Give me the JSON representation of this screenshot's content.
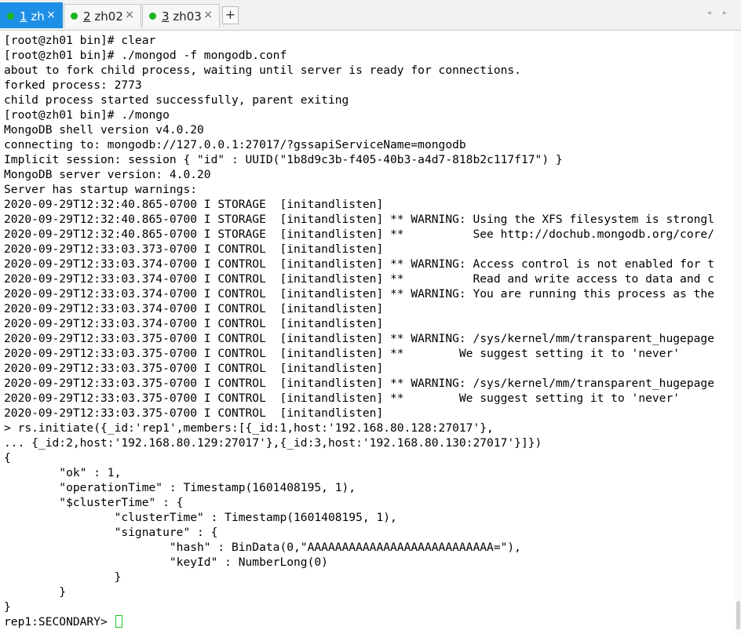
{
  "tabs": [
    {
      "num": "1",
      "name": "zh",
      "close": "×",
      "active": true
    },
    {
      "num": "2",
      "name": "zh02",
      "close": "×",
      "active": false
    },
    {
      "num": "3",
      "name": "zh03",
      "close": "×",
      "active": false
    }
  ],
  "new_tab_label": "+",
  "nav_arrows": "◂ ▸",
  "colors": {
    "active_tab": "#1e8fe6",
    "status_dot": "#18b51e",
    "cursor": "#19c419",
    "terminal_bg": "#ffffff",
    "terminal_fg": "#000000"
  },
  "terminal": {
    "lines": [
      "[root@zh01 bin]# clear",
      "[root@zh01 bin]# ./mongod -f mongodb.conf",
      "about to fork child process, waiting until server is ready for connections.",
      "forked process: 2773",
      "child process started successfully, parent exiting",
      "[root@zh01 bin]# ./mongo",
      "MongoDB shell version v4.0.20",
      "connecting to: mongodb://127.0.0.1:27017/?gssapiServiceName=mongodb",
      "Implicit session: session { \"id\" : UUID(\"1b8d9c3b-f405-40b3-a4d7-818b2c117f17\") }",
      "MongoDB server version: 4.0.20",
      "Server has startup warnings:",
      "2020-09-29T12:32:40.865-0700 I STORAGE  [initandlisten]",
      "2020-09-29T12:32:40.865-0700 I STORAGE  [initandlisten] ** WARNING: Using the XFS filesystem is strongl",
      "2020-09-29T12:32:40.865-0700 I STORAGE  [initandlisten] **          See http://dochub.mongodb.org/core/",
      "2020-09-29T12:33:03.373-0700 I CONTROL  [initandlisten]",
      "2020-09-29T12:33:03.374-0700 I CONTROL  [initandlisten] ** WARNING: Access control is not enabled for t",
      "2020-09-29T12:33:03.374-0700 I CONTROL  [initandlisten] **          Read and write access to data and c",
      "2020-09-29T12:33:03.374-0700 I CONTROL  [initandlisten] ** WARNING: You are running this process as the",
      "2020-09-29T12:33:03.374-0700 I CONTROL  [initandlisten]",
      "2020-09-29T12:33:03.374-0700 I CONTROL  [initandlisten]",
      "2020-09-29T12:33:03.375-0700 I CONTROL  [initandlisten] ** WARNING: /sys/kernel/mm/transparent_hugepage",
      "2020-09-29T12:33:03.375-0700 I CONTROL  [initandlisten] **        We suggest setting it to 'never'",
      "2020-09-29T12:33:03.375-0700 I CONTROL  [initandlisten]",
      "2020-09-29T12:33:03.375-0700 I CONTROL  [initandlisten] ** WARNING: /sys/kernel/mm/transparent_hugepage",
      "2020-09-29T12:33:03.375-0700 I CONTROL  [initandlisten] **        We suggest setting it to 'never'",
      "2020-09-29T12:33:03.375-0700 I CONTROL  [initandlisten]",
      "> rs.initiate({_id:'rep1',members:[{_id:1,host:'192.168.80.128:27017'},",
      "... {_id:2,host:'192.168.80.129:27017'},{_id:3,host:'192.168.80.130:27017'}]})",
      "{",
      "        \"ok\" : 1,",
      "        \"operationTime\" : Timestamp(1601408195, 1),",
      "        \"$clusterTime\" : {",
      "                \"clusterTime\" : Timestamp(1601408195, 1),",
      "                \"signature\" : {",
      "                        \"hash\" : BinData(0,\"AAAAAAAAAAAAAAAAAAAAAAAAAAA=\"),",
      "                        \"keyId\" : NumberLong(0)",
      "                }",
      "        }",
      "}"
    ],
    "prompt": "rep1:SECONDARY> "
  }
}
